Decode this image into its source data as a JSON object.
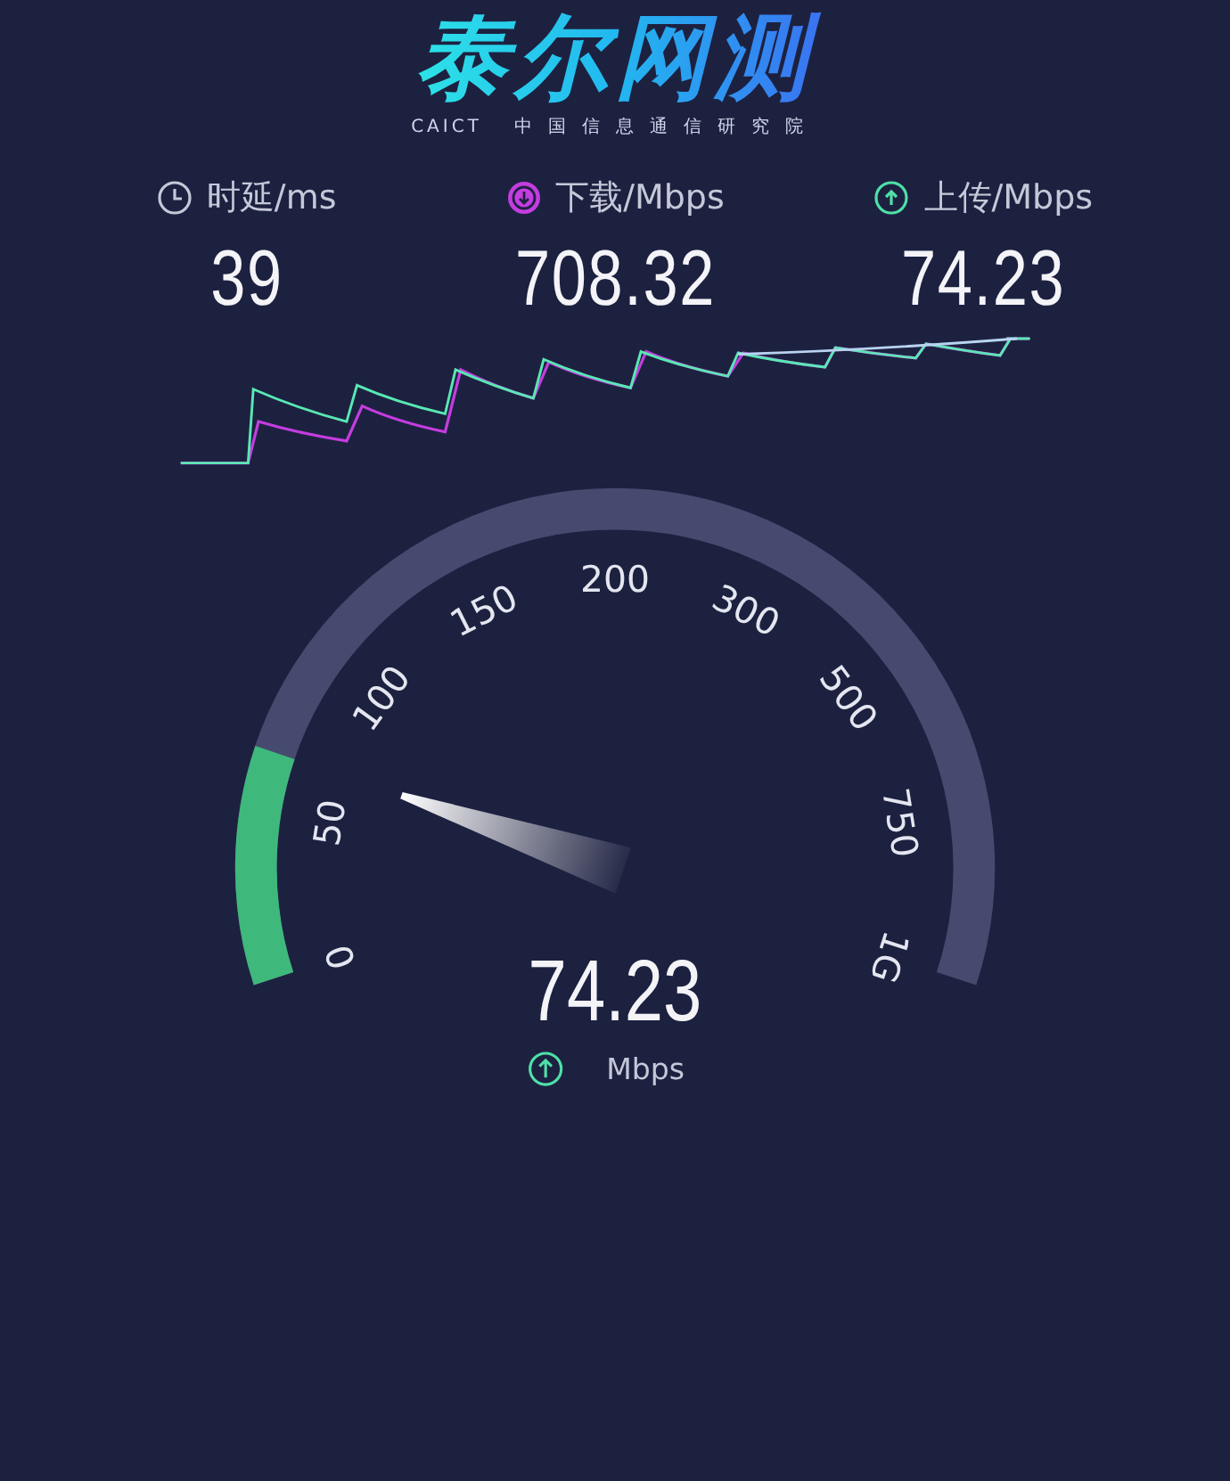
{
  "logo": {
    "title": "泰尔网测",
    "org_code": "CAICT",
    "org_name": "中国信息通信研究院"
  },
  "metrics": [
    {
      "kind": "latency",
      "label": "时延/ms",
      "value": "39"
    },
    {
      "kind": "download",
      "label": "下载/Mbps",
      "value": "708.32"
    },
    {
      "kind": "upload",
      "label": "上传/Mbps",
      "value": "74.23"
    }
  ],
  "gauge": {
    "kind": "upload",
    "value": "74.23",
    "unit": "Mbps",
    "ticks": [
      "0",
      "50",
      "100",
      "150",
      "200",
      "300",
      "500",
      "750",
      "1G"
    ]
  }
}
